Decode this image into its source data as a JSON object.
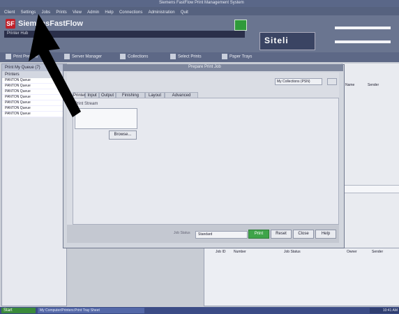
{
  "window": {
    "title": "Siemens FastFlow Print Management System"
  },
  "menu": [
    "Client",
    "Settings",
    "Jobs",
    "Prints",
    "View",
    "Admin",
    "Help",
    "Connections",
    "Administration",
    "Quit"
  ],
  "app": {
    "brand": "SiemensFastFlow",
    "logo_letter": "SF",
    "sub_bar": "Printer Hub"
  },
  "site": {
    "label": "Siteli"
  },
  "toolbar": [
    {
      "label": "Print Preview",
      "icon": "printer-icon"
    },
    {
      "label": "Server Manager",
      "icon": "server-icon"
    },
    {
      "label": "Collections",
      "icon": "folder-icon"
    },
    {
      "label": "Select Prints",
      "icon": "select-icon"
    },
    {
      "label": "Paper Trays",
      "icon": "tray-icon"
    }
  ],
  "left_panel": {
    "header": "Print My Queue (7)",
    "column": "Printers",
    "rows": [
      "PANTON Queue",
      "PANTON Queue",
      "PANTON Queue",
      "PANTON Queue",
      "PANTON Queue",
      "PANTON Queue",
      "PANTON Queue"
    ]
  },
  "dialog": {
    "title": "Prepare Print Job",
    "top_combo": "My Collections (PSN)",
    "tabs": [
      "Printer",
      "Input",
      "Output",
      "Finishing Options",
      "Layout",
      "Advanced Settings"
    ],
    "stack_label": "Print Stream",
    "browse_label": "Browse...",
    "status_label": "Job Status",
    "status_value": "Standard",
    "buttons": {
      "print": "Print",
      "reset": "Reset",
      "close": "Close",
      "help": "Help"
    }
  },
  "right_panel": {
    "col1": "Name",
    "col2": "Sender"
  },
  "bottom_panel": {
    "col1": "Job ID",
    "col2": "Number",
    "col3": "Job Status",
    "col4": "Owner",
    "col5": "Sender"
  },
  "taskbar": {
    "start": "Start",
    "item": "My Computer/Printers:Print Tray Sheet",
    "tray": "10:41 AM"
  }
}
